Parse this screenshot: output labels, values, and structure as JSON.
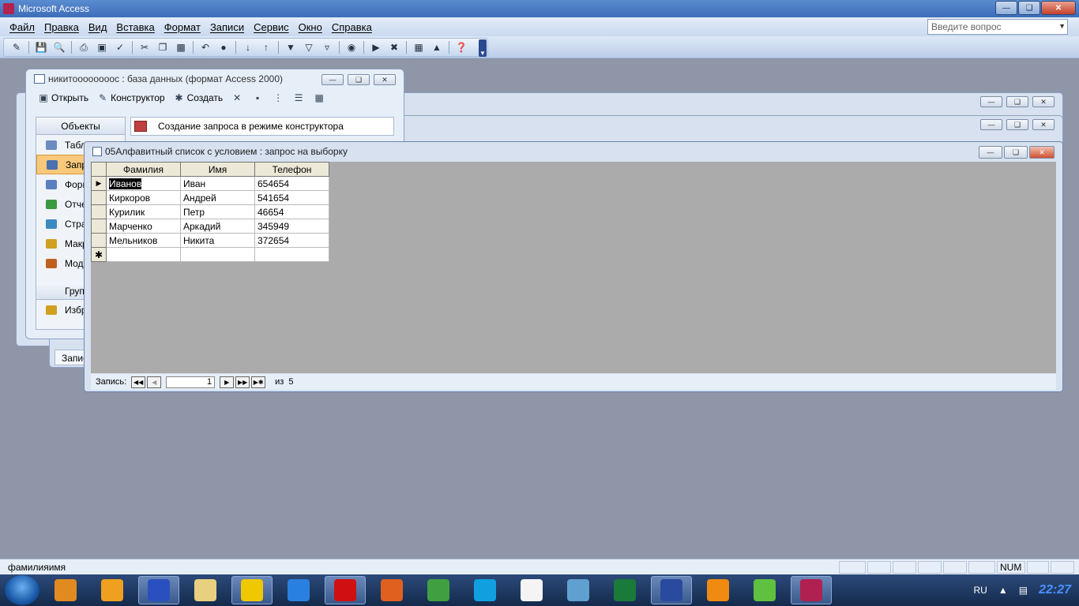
{
  "app": {
    "title": "Microsoft Access"
  },
  "menu": {
    "items": [
      "Файл",
      "Правка",
      "Вид",
      "Вставка",
      "Формат",
      "Записи",
      "Сервис",
      "Окно",
      "Справка"
    ],
    "ask_placeholder": "Введите вопрос"
  },
  "toolbar": {
    "icons": [
      "design-view-icon",
      "save-icon",
      "search-icon",
      "print-icon",
      "preview-icon",
      "spelling-icon",
      "cut-icon",
      "copy-icon",
      "paste-icon",
      "undo-icon",
      "hyperlink-icon",
      "sort-asc-icon",
      "sort-desc-icon",
      "filter-selection-icon",
      "filter-form-icon",
      "apply-filter-icon",
      "find-icon",
      "new-record-icon",
      "delete-record-icon",
      "database-window-icon",
      "new-object-icon",
      "help-icon"
    ]
  },
  "db_window": {
    "title": "никитоооооооос : база данных (формат Access 2000)",
    "toolbar": {
      "open": "Открыть",
      "design": "Конструктор",
      "create": "Создать"
    },
    "sidebar": {
      "header": "Объекты",
      "items": [
        {
          "label": "Таблицы",
          "icon": "table-icon",
          "color": "#6a8cc0"
        },
        {
          "label": "Запросы",
          "icon": "query-icon",
          "color": "#4a70b0",
          "selected": true
        },
        {
          "label": "Формы",
          "icon": "form-icon",
          "color": "#5a80c0"
        },
        {
          "label": "Отчеты",
          "icon": "report-icon",
          "color": "#3a9a40"
        },
        {
          "label": "Страницы",
          "icon": "page-icon",
          "color": "#3a8ac0"
        },
        {
          "label": "Макросы",
          "icon": "macro-icon",
          "color": "#d0a020"
        },
        {
          "label": "Модули",
          "icon": "module-icon",
          "color": "#c06020"
        }
      ],
      "groups_label": "Группы",
      "favorites_label": "Избранное"
    },
    "list_item": "Создание запроса в режиме конструктора"
  },
  "query_window": {
    "title": "05Алфавитный список с условием : запрос на выборку",
    "columns": [
      "Фамилия",
      "Имя",
      "Телефон"
    ],
    "rows": [
      [
        "Иванов",
        "Иван",
        "654654"
      ],
      [
        "Киркоров",
        "Андрей",
        "541654"
      ],
      [
        "Курилик",
        "Петр",
        "46654"
      ],
      [
        "Марченко",
        "Аркадий",
        "345949"
      ],
      [
        "Мельников",
        "Никита",
        "372654"
      ]
    ],
    "nav": {
      "label": "Запись:",
      "current": "1",
      "of": "из",
      "total": "5"
    }
  },
  "background_tab": {
    "label": "Запис"
  },
  "statusbar": {
    "text": "фамилияимя",
    "num": "NUM"
  },
  "taskbar": {
    "apps": [
      {
        "icon": "book-icon",
        "color": "#e08a20"
      },
      {
        "icon": "avast-icon",
        "color": "#f0a020"
      },
      {
        "icon": "floppy-save-icon",
        "color": "#2a50c0",
        "active": true
      },
      {
        "icon": "folder-icon",
        "color": "#e8d080"
      },
      {
        "icon": "checkmark-icon",
        "color": "#f0c800",
        "active": true
      },
      {
        "icon": "ie-icon",
        "color": "#2a80e0"
      },
      {
        "icon": "opera-icon",
        "color": "#d01010",
        "active": true
      },
      {
        "icon": "firefox-icon",
        "color": "#e06020"
      },
      {
        "icon": "chrome-icon",
        "color": "#40a040"
      },
      {
        "icon": "skype-icon",
        "color": "#10a0e0"
      },
      {
        "icon": "cards-icon",
        "color": "#f4f4f4"
      },
      {
        "icon": "calendar-icon",
        "color": "#60a0d0"
      },
      {
        "icon": "excel-icon",
        "color": "#1a7a3a"
      },
      {
        "icon": "word-icon",
        "color": "#2a4aa0",
        "active": true
      },
      {
        "icon": "info-icon",
        "color": "#f08a10"
      },
      {
        "icon": "vector-icon",
        "color": "#60c040"
      },
      {
        "icon": "access-icon",
        "color": "#b02050",
        "active": true
      }
    ],
    "tray": {
      "lang": "RU",
      "clock": "22:27"
    }
  }
}
